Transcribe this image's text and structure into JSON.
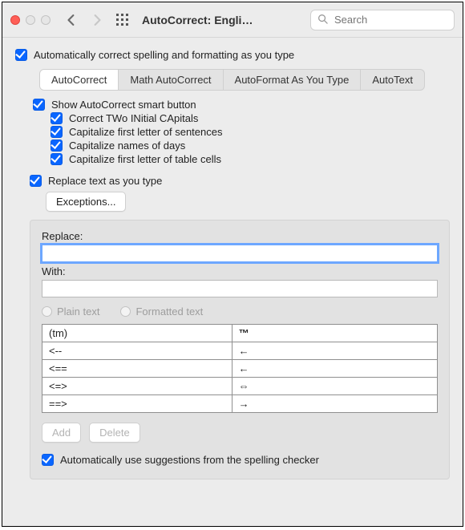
{
  "window": {
    "title": "AutoCorrect: Engli…"
  },
  "search": {
    "placeholder": "Search",
    "value": ""
  },
  "top_checkbox": {
    "label": "Automatically correct spelling and formatting as you type"
  },
  "tabs": {
    "items": [
      {
        "label": "AutoCorrect"
      },
      {
        "label": "Math AutoCorrect"
      },
      {
        "label": "AutoFormat As You Type"
      },
      {
        "label": "AutoText"
      }
    ],
    "active_index": 0
  },
  "smart_button": {
    "label": "Show AutoCorrect smart button",
    "children": [
      {
        "label": "Correct TWo INitial CApitals"
      },
      {
        "label": "Capitalize first letter of sentences"
      },
      {
        "label": "Capitalize names of days"
      },
      {
        "label": "Capitalize first letter of table cells"
      }
    ]
  },
  "replace_as_you_type": {
    "label": "Replace text as you type"
  },
  "exceptions_button": "Exceptions...",
  "panel": {
    "replace_label": "Replace:",
    "with_label": "With:",
    "replace_value": "",
    "with_value": "",
    "radio_plain": "Plain text",
    "radio_formatted": "Formatted text",
    "rows": [
      {
        "from": "(tm)",
        "to": "™"
      },
      {
        "from": "<--",
        "to": "←"
      },
      {
        "from": "<==",
        "to": "←"
      },
      {
        "from": "<=>",
        "to": "⇔"
      },
      {
        "from": "==>",
        "to": "→"
      }
    ],
    "add_button": "Add",
    "delete_button": "Delete"
  },
  "spell_suggestions": {
    "label": "Automatically use suggestions from the spelling checker"
  }
}
